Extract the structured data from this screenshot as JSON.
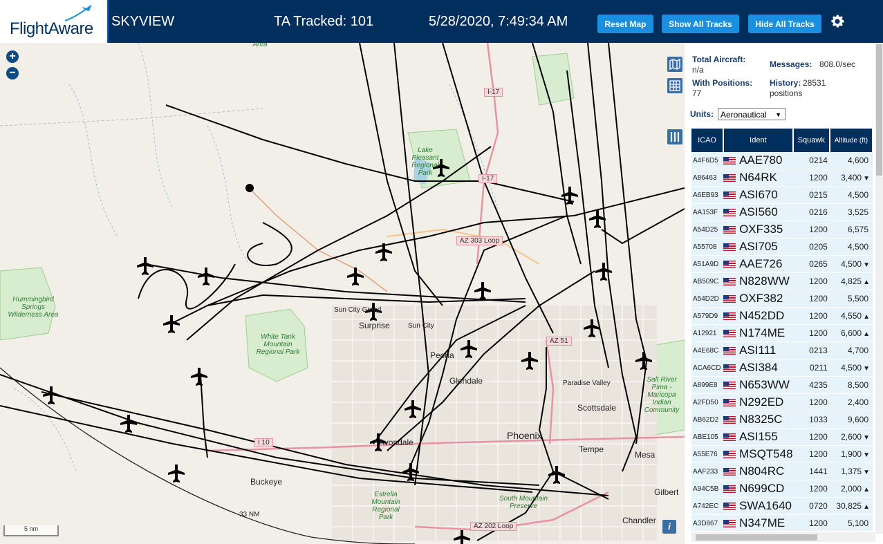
{
  "header": {
    "logo_text": "FlightAware",
    "app_title": "SKYVIEW",
    "ta_tracked": "TA Tracked: 101",
    "datetime": "5/28/2020, 7:49:34 AM",
    "buttons": {
      "reset": "Reset Map",
      "show_all": "Show All Tracks",
      "hide_all": "Hide All Tracks"
    },
    "settings_icon": "gear-icon"
  },
  "map": {
    "zoom_in": "+",
    "zoom_out": "−",
    "scale_label": "5 nm",
    "range_ring_label": "33 NM",
    "info_button": "i",
    "place_labels": {
      "surprise": "Surprise",
      "sun_city_grand": "Sun City Grand",
      "sun_city": "Sun City",
      "peoria": "Peoria",
      "glendale": "Glendale",
      "phoenix": "Phoenix",
      "scottsdale": "Scottsdale",
      "paradise_valley": "Paradise Valley",
      "tempe": "Tempe",
      "mesa": "Mesa",
      "buckeye": "Buckeye",
      "chandler": "Chandler",
      "gilbert": "Gilbert",
      "avondale": "Avondale"
    },
    "park_labels": {
      "lake_pleasant": "Lake Pleasant Regional Park",
      "white_tank": "White Tank Mountain Regional Park",
      "hummingbird": "Hummingbird Springs Wilderness Area",
      "estrella": "Estrella Mountain Regional Park",
      "south_mountain": "South Mountain Preserve",
      "salt_river": "Salt River Pima - Maricopa Indian Community",
      "area_top": "Area"
    },
    "road_labels": {
      "i17_a": "I-17",
      "i17_b": "I-17",
      "az303": "AZ 303 Loop",
      "az51": "AZ 51",
      "i10": "I 10",
      "az202": "AZ 202 Loop"
    }
  },
  "panel": {
    "total_aircraft_label": "Total Aircraft:",
    "total_aircraft_value": "n/a",
    "messages_label": "Messages:",
    "messages_value": "808.0/sec",
    "with_positions_label": "With Positions:",
    "with_positions_value": "77",
    "history_label": "History:",
    "history_value": "28531",
    "history_unit": "positions",
    "units_label": "Units:",
    "units_value": "Aeronautical",
    "columns": [
      "ICAO",
      "Ident",
      "Squawk",
      "Altitude (ft)"
    ],
    "rows": [
      {
        "icao": "A4F6D5",
        "ident": "AAE780",
        "squawk": "0214",
        "alt": "4,600",
        "trend": ""
      },
      {
        "icao": "A86463",
        "ident": "N64RK",
        "squawk": "1200",
        "alt": "3,400",
        "trend": "▼"
      },
      {
        "icao": "A6EB93",
        "ident": "ASI670",
        "squawk": "0215",
        "alt": "4,500",
        "trend": ""
      },
      {
        "icao": "AA153F",
        "ident": "ASI560",
        "squawk": "0216",
        "alt": "3,525",
        "trend": ""
      },
      {
        "icao": "A54D25",
        "ident": "OXF335",
        "squawk": "1200",
        "alt": "6,575",
        "trend": ""
      },
      {
        "icao": "A55708",
        "ident": "ASI705",
        "squawk": "0205",
        "alt": "4,500",
        "trend": ""
      },
      {
        "icao": "A51A9D",
        "ident": "AAE726",
        "squawk": "0265",
        "alt": "4,500",
        "trend": "▼"
      },
      {
        "icao": "AB509C",
        "ident": "N828WW",
        "squawk": "1200",
        "alt": "4,825",
        "trend": "▲"
      },
      {
        "icao": "A54D2D",
        "ident": "OXF382",
        "squawk": "1200",
        "alt": "5,500",
        "trend": ""
      },
      {
        "icao": "A579D9",
        "ident": "N452DD",
        "squawk": "1200",
        "alt": "4,550",
        "trend": "▲"
      },
      {
        "icao": "A12921",
        "ident": "N174ME",
        "squawk": "1200",
        "alt": "6,600",
        "trend": "▲"
      },
      {
        "icao": "A4E68C",
        "ident": "ASI111",
        "squawk": "0213",
        "alt": "4,700",
        "trend": ""
      },
      {
        "icao": "ACA6CD",
        "ident": "ASI384",
        "squawk": "0211",
        "alt": "4,500",
        "trend": "▼"
      },
      {
        "icao": "A899E8",
        "ident": "N653WW",
        "squawk": "4235",
        "alt": "8,500",
        "trend": ""
      },
      {
        "icao": "A2FD50",
        "ident": "N292ED",
        "squawk": "1200",
        "alt": "2,400",
        "trend": ""
      },
      {
        "icao": "AB62D2",
        "ident": "N8325C",
        "squawk": "1033",
        "alt": "9,600",
        "trend": ""
      },
      {
        "icao": "ABE105",
        "ident": "ASI155",
        "squawk": "1200",
        "alt": "2,600",
        "trend": "▼"
      },
      {
        "icao": "A55E76",
        "ident": "MSQT548",
        "squawk": "1200",
        "alt": "1,900",
        "trend": "▼"
      },
      {
        "icao": "AAF233",
        "ident": "N804RC",
        "squawk": "1441",
        "alt": "1,375",
        "trend": "▼"
      },
      {
        "icao": "A94C5B",
        "ident": "N699CD",
        "squawk": "1200",
        "alt": "2,000",
        "trend": "▲"
      },
      {
        "icao": "A742EC",
        "ident": "SWA1640",
        "squawk": "0720",
        "alt": "30,825",
        "trend": "▲"
      },
      {
        "icao": "A3D867",
        "ident": "N347ME",
        "squawk": "1200",
        "alt": "5,100",
        "trend": ""
      }
    ]
  }
}
